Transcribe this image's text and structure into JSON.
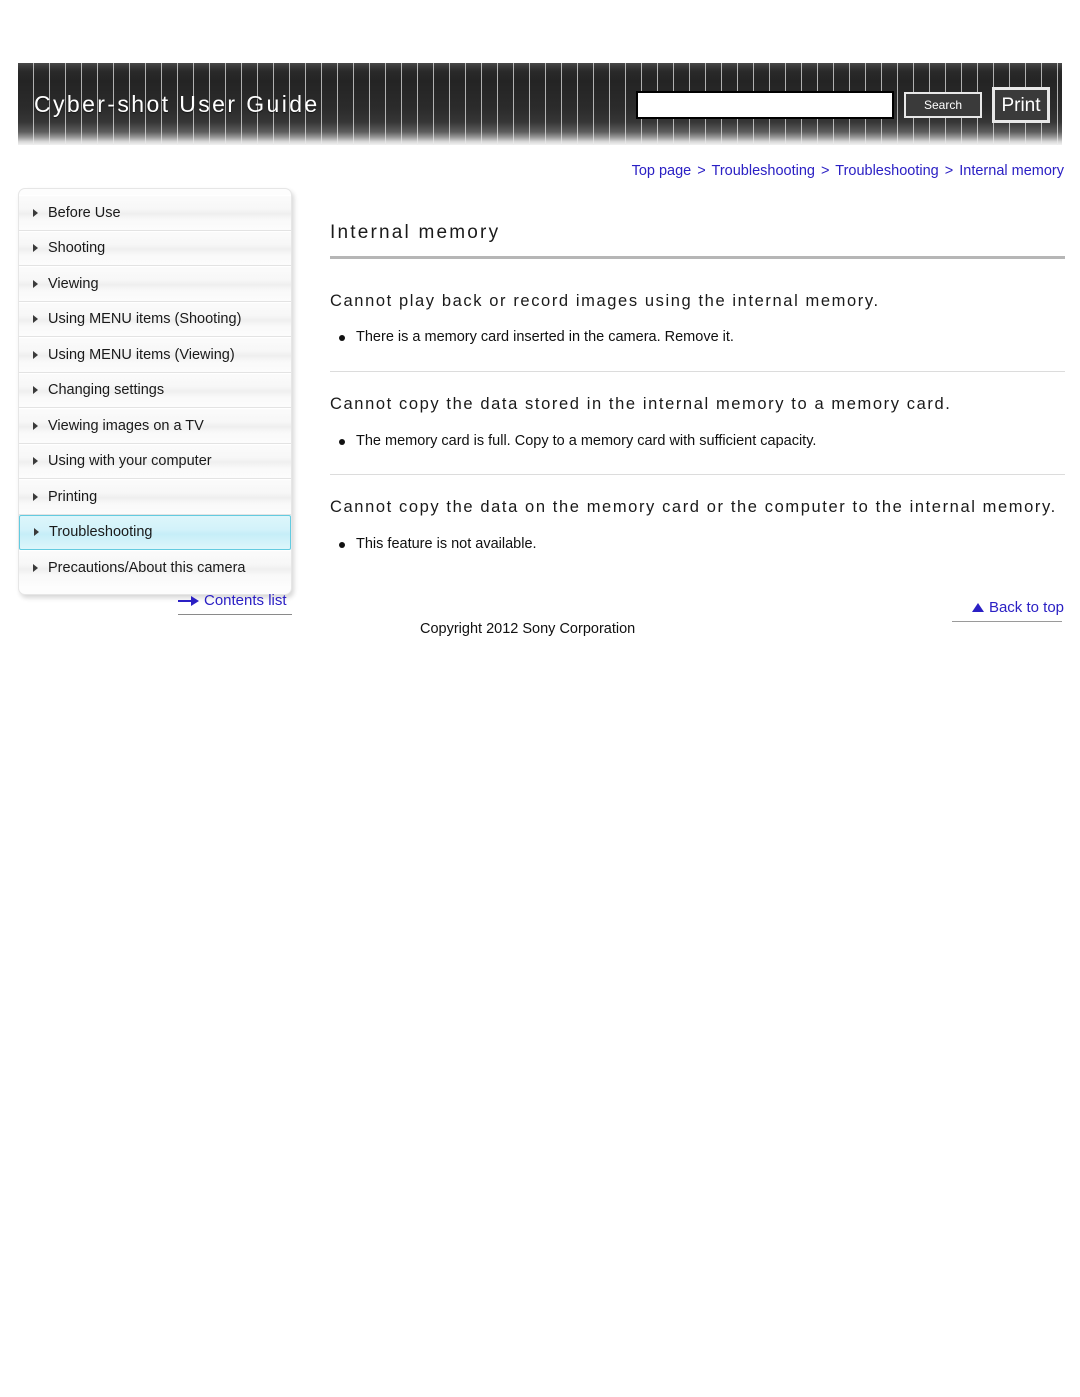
{
  "header": {
    "title": "Cyber-shot User Guide",
    "search_value": "",
    "search_placeholder": "",
    "search_button": "Search",
    "print_button": "Print"
  },
  "breadcrumb": {
    "items": [
      "Top page",
      "Troubleshooting",
      "Troubleshooting",
      "Internal memory"
    ],
    "separator": ">"
  },
  "sidebar": {
    "items": [
      {
        "label": "Before Use",
        "active": false
      },
      {
        "label": "Shooting",
        "active": false
      },
      {
        "label": "Viewing",
        "active": false
      },
      {
        "label": "Using MENU items (Shooting)",
        "active": false
      },
      {
        "label": "Using MENU items (Viewing)",
        "active": false
      },
      {
        "label": "Changing settings",
        "active": false
      },
      {
        "label": "Viewing images on a TV",
        "active": false
      },
      {
        "label": "Using with your computer",
        "active": false
      },
      {
        "label": "Printing",
        "active": false
      },
      {
        "label": "Troubleshooting",
        "active": true
      },
      {
        "label": "Precautions/About this camera",
        "active": false
      }
    ]
  },
  "main": {
    "title": "Internal memory",
    "sections": [
      {
        "heading": "Cannot play back or record images using the internal memory.",
        "bullets": [
          "There is a memory card inserted in the camera. Remove it."
        ]
      },
      {
        "heading": "Cannot copy the data stored in the internal memory to a memory card.",
        "bullets": [
          "The memory card is full. Copy to a memory card with sufficient capacity."
        ]
      },
      {
        "heading": "Cannot copy the data on the memory card or the computer to the internal memory.",
        "bullets": [
          "This feature is not available."
        ]
      }
    ]
  },
  "footer": {
    "contents_list": "Contents list",
    "back_to_top": "Back to top",
    "copyright": "Copyright 2012 Sony Corporation"
  },
  "colors": {
    "link": "#2b20c4",
    "active_nav_bg": "#d3f2fa",
    "active_nav_border": "#63cbe0",
    "header_dark": "#242424"
  }
}
